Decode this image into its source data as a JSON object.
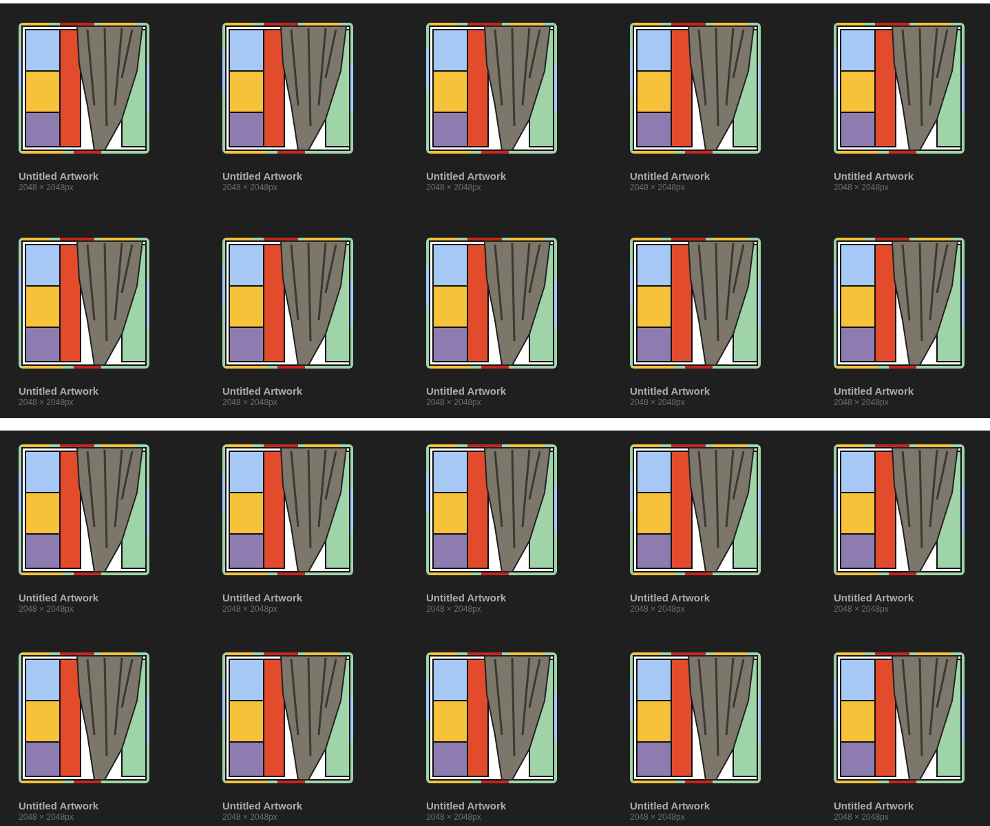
{
  "galleries": [
    {
      "artworks": [
        {
          "title": "Untitled Artwork",
          "size": "2048 × 2048px"
        },
        {
          "title": "Untitled Artwork",
          "size": "2048 × 2048px"
        },
        {
          "title": "Untitled Artwork",
          "size": "2048 × 2048px"
        },
        {
          "title": "Untitled Artwork",
          "size": "2048 × 2048px"
        },
        {
          "title": "Untitled Artwork",
          "size": "2048 × 2048px"
        },
        {
          "title": "Untitled Artwork",
          "size": "2048 × 2048px"
        },
        {
          "title": "Untitled Artwork",
          "size": "2048 × 2048px"
        },
        {
          "title": "Untitled Artwork",
          "size": "2048 × 2048px"
        },
        {
          "title": "Untitled Artwork",
          "size": "2048 × 2048px"
        },
        {
          "title": "Untitled Artwork",
          "size": "2048 × 2048px"
        }
      ]
    },
    {
      "artworks": [
        {
          "title": "Untitled Artwork",
          "size": "2048 × 2048px"
        },
        {
          "title": "Untitled Artwork",
          "size": "2048 × 2048px"
        },
        {
          "title": "Untitled Artwork",
          "size": "2048 × 2048px"
        },
        {
          "title": "Untitled Artwork",
          "size": "2048 × 2048px"
        },
        {
          "title": "Untitled Artwork",
          "size": "2048 × 2048px"
        },
        {
          "title": "Untitled Artwork",
          "size": "2048 × 2048px"
        },
        {
          "title": "Untitled Artwork",
          "size": "2048 × 2048px"
        },
        {
          "title": "Untitled Artwork",
          "size": "2048 × 2048px"
        },
        {
          "title": "Untitled Artwork",
          "size": "2048 × 2048px"
        },
        {
          "title": "Untitled Artwork",
          "size": "2048 × 2048px"
        }
      ]
    }
  ]
}
